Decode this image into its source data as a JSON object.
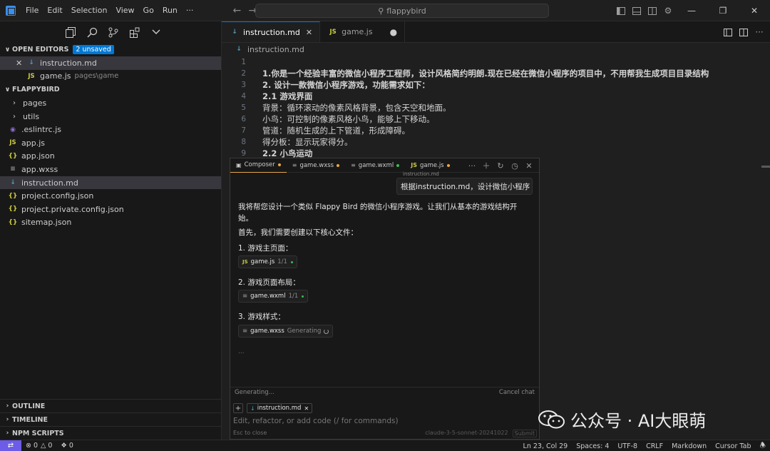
{
  "titlebar": {
    "menu": [
      "File",
      "Edit",
      "Selection",
      "View",
      "Go",
      "Run",
      "···"
    ],
    "search_text": "flappybird"
  },
  "sidebar": {
    "open_editors_label": "OPEN EDITORS",
    "unsaved_badge": "2 unsaved",
    "open_editors": [
      {
        "name": "instruction.md",
        "path": ""
      },
      {
        "name": "game.js",
        "path": "pages\\game"
      }
    ],
    "project_label": "FLAPPYBIRD",
    "tree": [
      {
        "name": "pages",
        "kind": "folder"
      },
      {
        "name": "utils",
        "kind": "folder"
      },
      {
        "name": ".eslintrc.js",
        "kind": "eslint"
      },
      {
        "name": "app.js",
        "kind": "js"
      },
      {
        "name": "app.json",
        "kind": "json"
      },
      {
        "name": "app.wxss",
        "kind": "wxss"
      },
      {
        "name": "instruction.md",
        "kind": "md"
      },
      {
        "name": "project.config.json",
        "kind": "json"
      },
      {
        "name": "project.private.config.json",
        "kind": "json"
      },
      {
        "name": "sitemap.json",
        "kind": "json"
      }
    ],
    "bottom_sections": [
      "OUTLINE",
      "TIMELINE",
      "NPM SCRIPTS"
    ]
  },
  "editor": {
    "tabs": [
      {
        "label": "instruction.md",
        "icon": "md"
      },
      {
        "label": "game.js",
        "icon": "js"
      }
    ],
    "breadcrumb": "instruction.md",
    "lines": [
      {
        "n": "1",
        "text": ""
      },
      {
        "n": "2",
        "text": "1.你是一个经验丰富的微信小程序工程师，设计风格简约明朗.现在已经在微信小程序的项目中，不用帮我生成项目目录结构"
      },
      {
        "n": "3",
        "text": "2. 设计一款微信小程序游戏，功能需求如下："
      },
      {
        "n": "4",
        "text": "2.1 游戏界面"
      },
      {
        "n": "5",
        "text": "背景：循环滚动的像素风格背景，包含天空和地面。"
      },
      {
        "n": "6",
        "text": "小鸟：可控制的像素风格小鸟，能够上下移动。"
      },
      {
        "n": "7",
        "text": "管道：随机生成的上下管道，形成障碍。"
      },
      {
        "n": "8",
        "text": "得分板：显示玩家得分。"
      },
      {
        "n": "9",
        "text": "2.2 小鸟运动"
      }
    ]
  },
  "composer": {
    "tabs": [
      {
        "label": "Composer",
        "dot": "#e8a948"
      },
      {
        "label": "game.wxss",
        "dot": "#e8a948"
      },
      {
        "label": "game.wxml",
        "dot": "#3fb950"
      },
      {
        "label": "game.js",
        "dot": "#e8a948"
      }
    ],
    "user_ref": "instruction.md",
    "user_message": "根据instruction.md，设计微信小程序",
    "intro": "我将帮您设计一个类似 Flappy Bird 的微信小程序游戏。让我们从基本的游戏结构开始。",
    "first_line": "首先，我们需要创建以下核心文件：",
    "steps": [
      {
        "title": "1. 游戏主页面：",
        "file": "game.js",
        "count": "1/1",
        "status": ""
      },
      {
        "title": "2. 游戏页面布局：",
        "file": "game.wxml",
        "count": "1/1",
        "status": ""
      },
      {
        "title": "3. 游戏样式：",
        "file": "game.wxss",
        "count": "",
        "status": "Generating"
      }
    ],
    "ellipsis": "...",
    "generating_text": "Generating...",
    "cancel_text": "Cancel chat",
    "context_file": "instruction.md",
    "input_placeholder": "Edit, refactor, or add code (/ for commands)",
    "esc_hint": "Esc to close",
    "model": "claude-3-5-sonnet-20241022",
    "submit": "Submit"
  },
  "watermark": {
    "text": "公众号 · AI大眼萌"
  },
  "statusbar": {
    "errors": "0",
    "warnings": "0",
    "ports": "0",
    "position": "Ln 23, Col 29",
    "spaces": "Spaces: 4",
    "encoding": "UTF-8",
    "eol": "CRLF",
    "language": "Markdown",
    "cursor_tab": "Cursor Tab"
  }
}
